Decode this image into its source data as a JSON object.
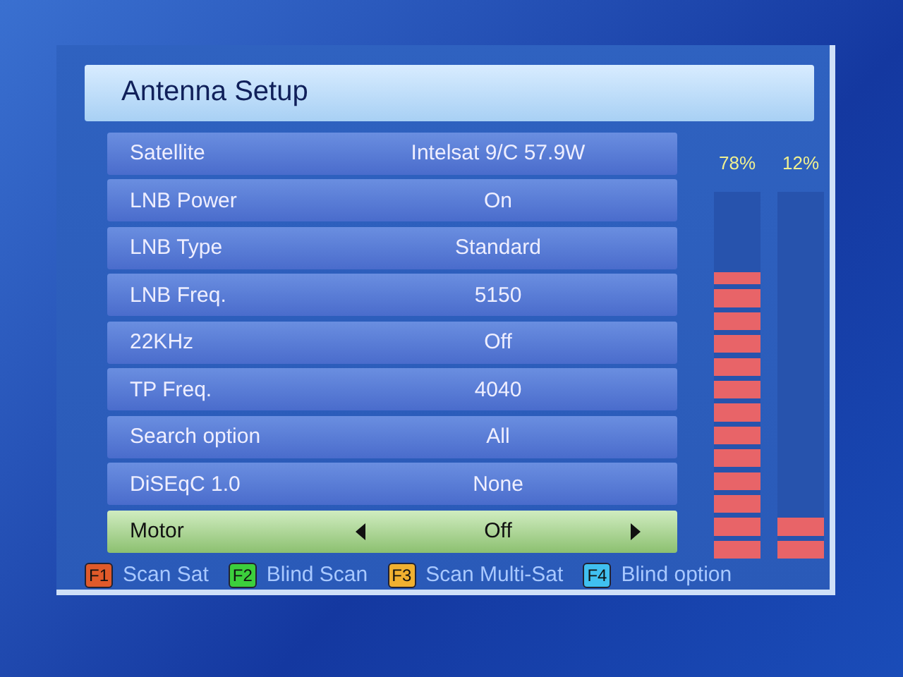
{
  "screen": {
    "title": "Antenna Setup"
  },
  "settings": [
    {
      "label": "Satellite",
      "value": "Intelsat 9/C 57.9W",
      "selected": false
    },
    {
      "label": "LNB Power",
      "value": "On",
      "selected": false
    },
    {
      "label": "LNB Type",
      "value": "Standard",
      "selected": false
    },
    {
      "label": "LNB Freq.",
      "value": "5150",
      "selected": false
    },
    {
      "label": "22KHz",
      "value": "Off",
      "selected": false
    },
    {
      "label": "TP Freq.",
      "value": "4040",
      "selected": false
    },
    {
      "label": "Search option",
      "value": "All",
      "selected": false
    },
    {
      "label": "DiSEqC 1.0",
      "value": "None",
      "selected": false
    },
    {
      "label": "Motor",
      "value": "Off",
      "selected": true
    }
  ],
  "meters": [
    {
      "reading": "78%",
      "level": 0.78
    },
    {
      "reading": "12%",
      "level": 0.12
    }
  ],
  "function_keys": [
    {
      "key": "F1",
      "label": "Scan Sat",
      "color": "#e05a2a"
    },
    {
      "key": "F2",
      "label": "Blind Scan",
      "color": "#3ccf3c"
    },
    {
      "key": "F3",
      "label": "Scan Multi-Sat",
      "color": "#f0b030"
    },
    {
      "key": "F4",
      "label": "Blind option",
      "color": "#40c0f0"
    }
  ]
}
